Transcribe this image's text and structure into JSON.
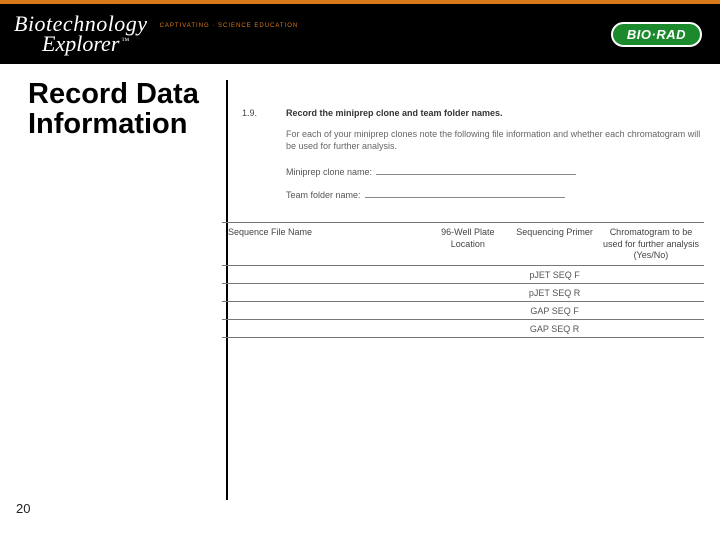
{
  "brand": {
    "line1": "Biotechnology",
    "tagline": "CAPTIVATING · SCIENCE EDUCATION",
    "line2": "Explorer",
    "tm": "™",
    "logo": "BIO·RAD"
  },
  "title": "Record Data Information",
  "instruction": {
    "number": "1.9.",
    "heading": "Record the miniprep clone and team folder names.",
    "body": "For each of your miniprep clones note the following file information and whether each chromatogram will be used for further analysis."
  },
  "fields": {
    "clone_label": "Miniprep clone name:",
    "folder_label": "Team folder name:"
  },
  "table": {
    "headers": {
      "file": "Sequence File Name",
      "plate": "96-Well Plate Location",
      "primer": "Sequencing Primer",
      "chrom": "Chromatogram to be used for further analysis (Yes/No)"
    },
    "rows": [
      {
        "primer": "pJET SEQ F"
      },
      {
        "primer": "pJET SEQ R"
      },
      {
        "primer": "GAP SEQ F"
      },
      {
        "primer": "GAP SEQ R"
      }
    ]
  },
  "page_number": "20"
}
